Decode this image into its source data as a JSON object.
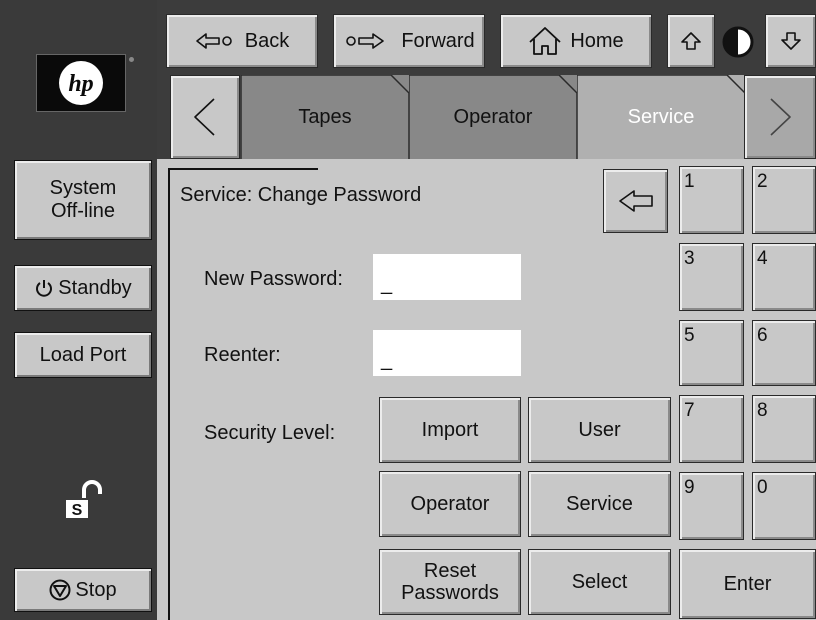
{
  "nav": {
    "back_label": "Back",
    "forward_label": "Forward",
    "home_label": "Home"
  },
  "brand": {
    "logo_text": "hp"
  },
  "sidebar": {
    "status_label": "System\nOff-line",
    "standby_label": "Standby",
    "load_port_label": "Load Port",
    "lock_letter": "S",
    "stop_label": "Stop"
  },
  "tabs": [
    {
      "label": "Tapes",
      "active": false
    },
    {
      "label": "Operator",
      "active": false
    },
    {
      "label": "Service",
      "active": true
    }
  ],
  "form": {
    "title": "Service: Change Password",
    "new_password_label": "New Password:",
    "new_password_value": "_",
    "reenter_label": "Reenter:",
    "reenter_value": "_",
    "security_level_label": "Security Level:",
    "level_buttons": [
      "Import",
      "User",
      "Operator",
      "Service"
    ],
    "reset_label": "Reset\nPasswords",
    "select_label": "Select",
    "enter_label": "Enter"
  },
  "keypad": {
    "keys": [
      "1",
      "2",
      "3",
      "4",
      "5",
      "6",
      "7",
      "8",
      "9",
      "0"
    ]
  },
  "colors": {
    "panel": "#c8c8c8",
    "frame": "#3a3a3a",
    "active_tab": "#b0b0b0",
    "active_tab_text": "#ffffff"
  }
}
